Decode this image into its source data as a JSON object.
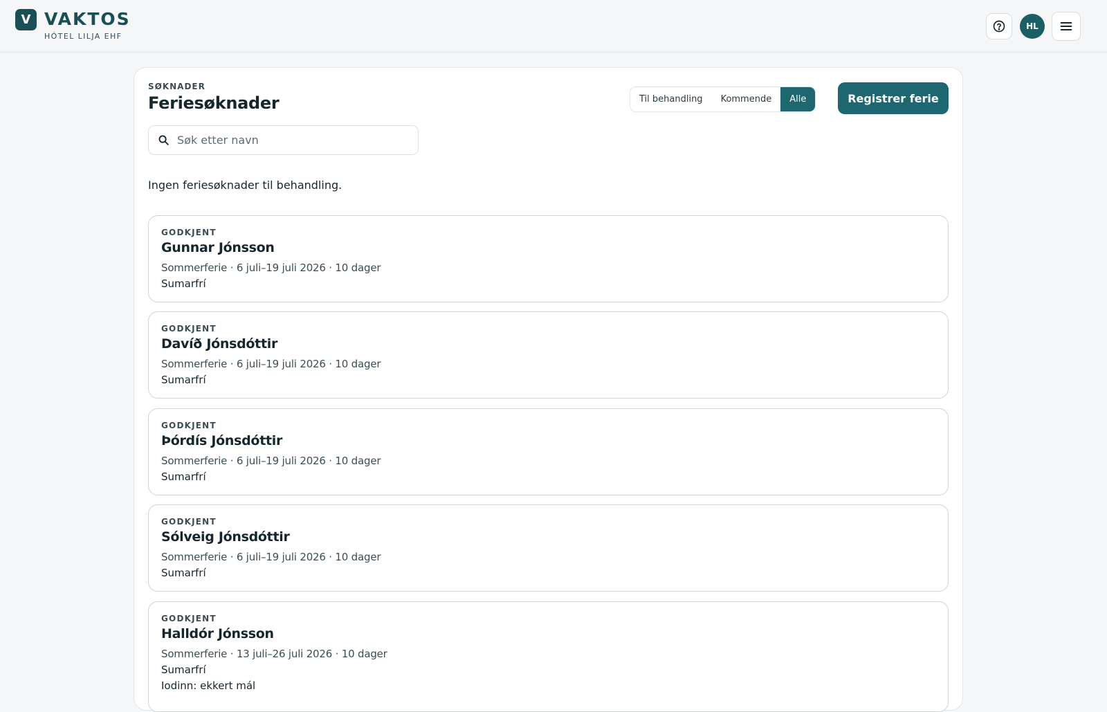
{
  "brand": {
    "mark": "V",
    "name": "VAKTOS",
    "subtitle": "HÓTEL LILJA EHF"
  },
  "header": {
    "avatar_initials": "HL",
    "icons": {
      "help": "help-circle-icon",
      "menu": "hamburger-menu-icon"
    }
  },
  "panel": {
    "eyebrow": "SØKNADER",
    "title": "Feriesøknader",
    "filters": [
      {
        "label": "Til behandling",
        "active": false
      },
      {
        "label": "Kommende",
        "active": false
      },
      {
        "label": "Alle",
        "active": true
      }
    ],
    "register_label": "Registrer ferie",
    "search": {
      "placeholder": "Søk etter navn",
      "value": ""
    },
    "empty_message": "Ingen feriesøknader til behandling."
  },
  "requests": [
    {
      "status": "GODKJENT",
      "name": "Gunnar Jónsson",
      "meta": "Sommerferie · 6 juli–19 juli 2026 · 10 dager",
      "note": "Sumarfrí"
    },
    {
      "status": "GODKJENT",
      "name": "Davíð Jónsdóttir",
      "meta": "Sommerferie · 6 juli–19 juli 2026 · 10 dager",
      "note": "Sumarfrí"
    },
    {
      "status": "GODKJENT",
      "name": "Þórdís Jónsdóttir",
      "meta": "Sommerferie · 6 juli–19 juli 2026 · 10 dager",
      "note": "Sumarfrí"
    },
    {
      "status": "GODKJENT",
      "name": "Sólveig Jónsdóttir",
      "meta": "Sommerferie · 6 juli–19 juli 2026 · 10 dager",
      "note": "Sumarfrí"
    },
    {
      "status": "GODKJENT",
      "name": "Halldór Jónsson",
      "meta": "Sommerferie · 13 juli–26 juli 2026 · 10 dager",
      "note": "Sumarfrí",
      "extra": "Iodinn: ekkert mál"
    }
  ],
  "colors": {
    "accent": "#1e6670",
    "brand": "#1b4f56"
  }
}
